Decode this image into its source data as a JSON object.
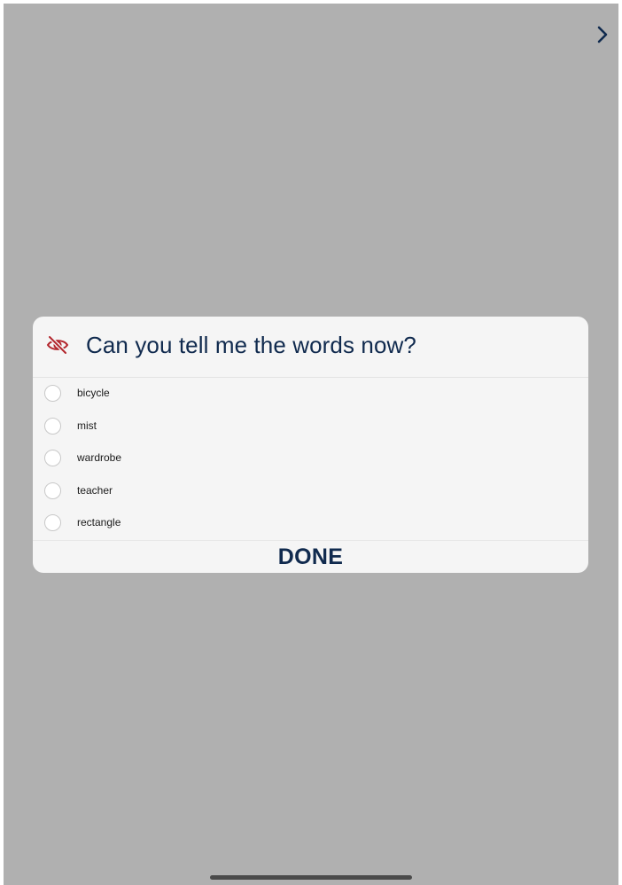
{
  "navigation": {
    "next_icon": "chevron-right-icon"
  },
  "dialog": {
    "icon": "eye-slash-icon",
    "title": "Can you tell me the words now?",
    "options": [
      {
        "label": "bicycle",
        "checked": false
      },
      {
        "label": "mist",
        "checked": false
      },
      {
        "label": "wardrobe",
        "checked": false
      },
      {
        "label": "teacher",
        "checked": false
      },
      {
        "label": "rectangle",
        "checked": false
      }
    ],
    "done_label": "DONE"
  },
  "colors": {
    "overlay_gray": "#b0b0b0",
    "dialog_background": "#f5f5f5",
    "title_navy": "#102a4e",
    "icon_red": "#b3262d"
  }
}
